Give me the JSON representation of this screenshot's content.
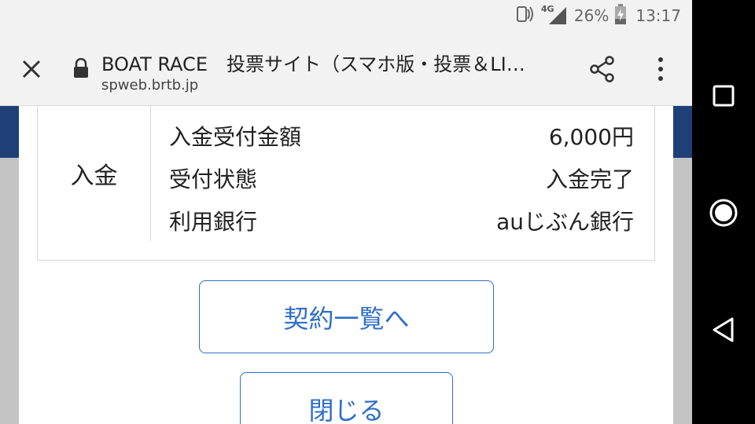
{
  "status_bar": {
    "network_label": "4G",
    "battery_percent": "26%",
    "time": "13:17",
    "icons": [
      "nfc-signal-icon",
      "cell-signal-icon",
      "battery-charging-icon"
    ]
  },
  "browser": {
    "title": "BOAT RACE　投票サイト（スマホ版・投票＆LI…",
    "url": "spweb.brtb.jp",
    "icons": [
      "close-icon",
      "lock-icon",
      "share-icon",
      "more-vert-icon"
    ]
  },
  "deposit": {
    "heading": "入金",
    "rows": [
      {
        "label": "入金受付金額",
        "value": "6,000円"
      },
      {
        "label": "受付状態",
        "value": "入金完了"
      },
      {
        "label": "利用銀行",
        "value": "auじぶん銀行"
      }
    ]
  },
  "buttons": {
    "contract_list": "契約一覧へ",
    "close": "閉じる"
  },
  "colors": {
    "accent": "#2e6ec8",
    "header_band": "#1f3f79",
    "overlay_gray": "#b5b5b5"
  },
  "nav_bar": {
    "icons": [
      "recents-icon",
      "home-icon",
      "back-icon"
    ]
  }
}
